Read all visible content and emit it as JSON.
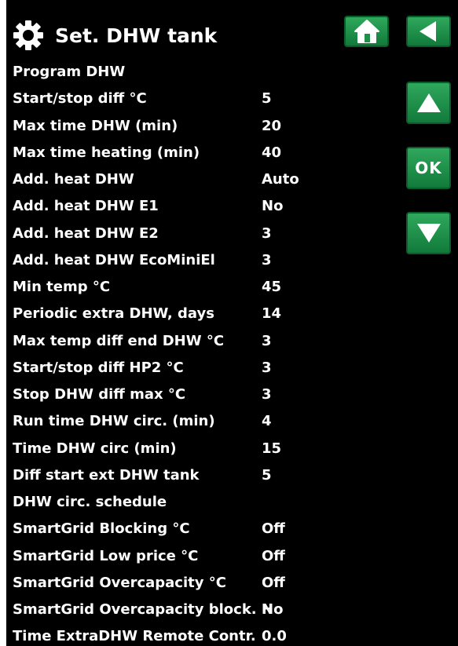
{
  "header": {
    "title": "Set. DHW tank",
    "icon": "gear-icon"
  },
  "nav": {
    "home_icon": "home-icon",
    "back_icon": "back-arrow-icon",
    "up_icon": "up-arrow-icon",
    "ok_label": "OK",
    "down_icon": "down-arrow-icon"
  },
  "colors": {
    "background": "#000000",
    "text": "#ffffff",
    "button_green": "#1f8f4a",
    "button_border": "#0c5b2b"
  },
  "settings": [
    {
      "label": "Program DHW",
      "value": ""
    },
    {
      "label": "Start/stop diff °C",
      "value": "5"
    },
    {
      "label": "Max time DHW (min)",
      "value": "20"
    },
    {
      "label": "Max time heating (min)",
      "value": "40"
    },
    {
      "label": "Add. heat DHW",
      "value": "Auto"
    },
    {
      "label": "Add. heat DHW E1",
      "value": "No"
    },
    {
      "label": "Add. heat DHW E2",
      "value": "3"
    },
    {
      "label": "Add. heat DHW EcoMiniEl",
      "value": "3"
    },
    {
      "label": "Min temp °C",
      "value": "45"
    },
    {
      "label": "Periodic extra DHW, days",
      "value": "14"
    },
    {
      "label": "Max temp diff end DHW °C",
      "value": "3"
    },
    {
      "label": "Start/stop diff HP2 °C",
      "value": "3"
    },
    {
      "label": "Stop DHW diff max °C",
      "value": "3"
    },
    {
      "label": "Run time DHW circ. (min)",
      "value": "4"
    },
    {
      "label": "Time DHW circ (min)",
      "value": "15"
    },
    {
      "label": "Diff start ext DHW tank",
      "value": "5"
    },
    {
      "label": "DHW circ. schedule",
      "value": ""
    },
    {
      "label": "SmartGrid Blocking °C",
      "value": "Off"
    },
    {
      "label": "SmartGrid Low price °C",
      "value": "Off"
    },
    {
      "label": "SmartGrid Overcapacity °C",
      "value": "Off"
    },
    {
      "label": "SmartGrid Overcapacity block. H",
      "value": "No"
    },
    {
      "label": "Time ExtraDHW Remote Contr.",
      "value": "0.0"
    }
  ]
}
